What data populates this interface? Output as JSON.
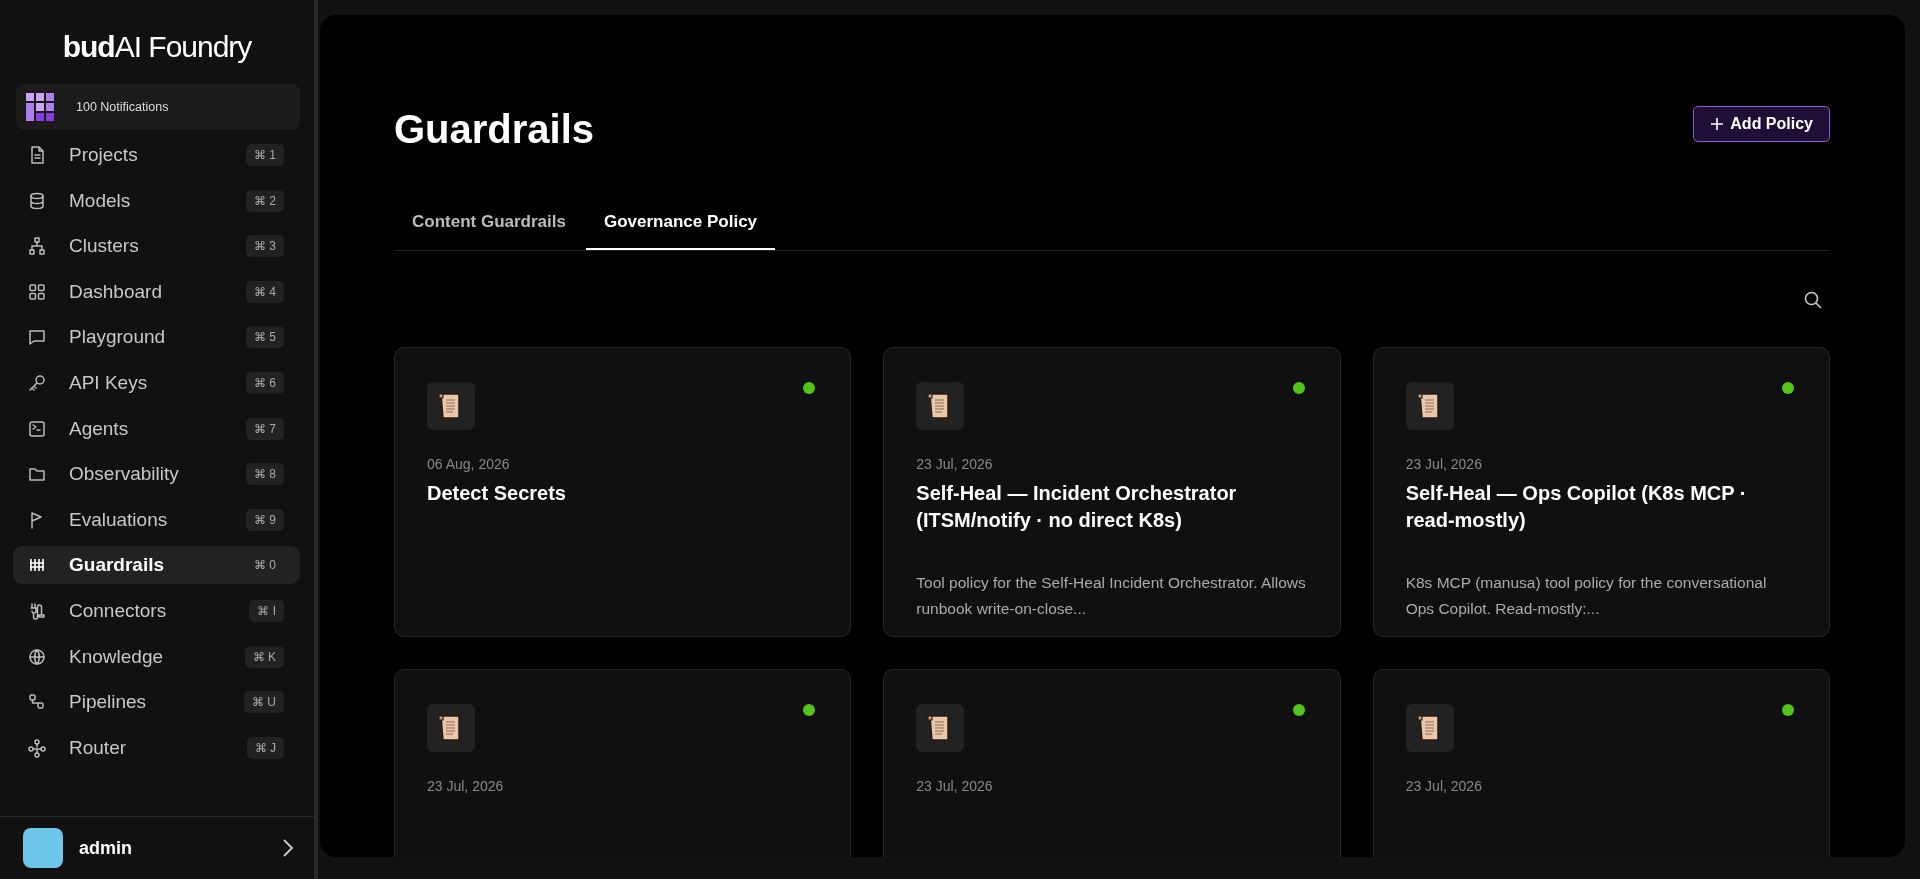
{
  "sidebar": {
    "logo": "**bud**AI Foundry",
    "notifications": "100 Notifications",
    "items": [
      {
        "label": "Projects",
        "shortcut": "⌘ 1",
        "selected": false
      },
      {
        "label": "Models",
        "shortcut": "⌘ 2",
        "selected": false
      },
      {
        "label": "Clusters",
        "shortcut": "⌘ 3",
        "selected": false
      },
      {
        "label": "Dashboard",
        "shortcut": "⌘ 4",
        "selected": false
      },
      {
        "label": "Playground",
        "shortcut": "⌘ 5",
        "selected": false
      },
      {
        "label": "API Keys",
        "shortcut": "⌘ 6",
        "selected": false
      },
      {
        "label": "Agents",
        "shortcut": "⌘ 7",
        "selected": false
      },
      {
        "label": "Observability",
        "shortcut": "⌘ 8",
        "selected": false
      },
      {
        "label": "Evaluations",
        "shortcut": "⌘ 9",
        "selected": false
      },
      {
        "label": "Guardrails",
        "shortcut": "⌘ 0",
        "selected": true
      },
      {
        "label": "Connectors",
        "shortcut": "⌘ I",
        "selected": false
      },
      {
        "label": "Knowledge",
        "shortcut": "⌘ K",
        "selected": false
      },
      {
        "label": "Pipelines",
        "shortcut": "⌘ U",
        "selected": false
      },
      {
        "label": "Router",
        "shortcut": "⌘ J",
        "selected": false
      }
    ],
    "user": {
      "name": "admin"
    }
  },
  "main": {
    "title": "Guardrails",
    "add_button": "Add Policy",
    "tabs": [
      {
        "label": "Content Guardrails",
        "selected": false
      },
      {
        "label": "Governance Policy",
        "selected": true
      }
    ],
    "cards": [
      {
        "date": "06 Aug, 2026",
        "title": "Detect Secrets",
        "color": "#52c41a"
      },
      {
        "date": "23 Jul, 2026",
        "title": "Self-Heal — Incident Orchestrator (ITSM/notify · no direct K8s)",
        "description": "Tool policy for the Self-Heal Incident Orchestrator. Allows runbook write-on-close...",
        "color": "#52c41a"
      },
      {
        "date": "23 Jul, 2026",
        "title": "Self-Heal — Ops Copilot (K8s MCP · read-mostly)",
        "description": "K8s MCP (manusa) tool policy for the conversational Ops Copilot. Read-mostly:...",
        "color": "#52c41a"
      },
      {
        "date": "23 Jul, 2026",
        "color": "#52c41a"
      },
      {
        "date": "23 Jul, 2026",
        "color": "#52c41a"
      },
      {
        "date": "23 Jul, 2026",
        "color": "#52c41a"
      }
    ]
  }
}
